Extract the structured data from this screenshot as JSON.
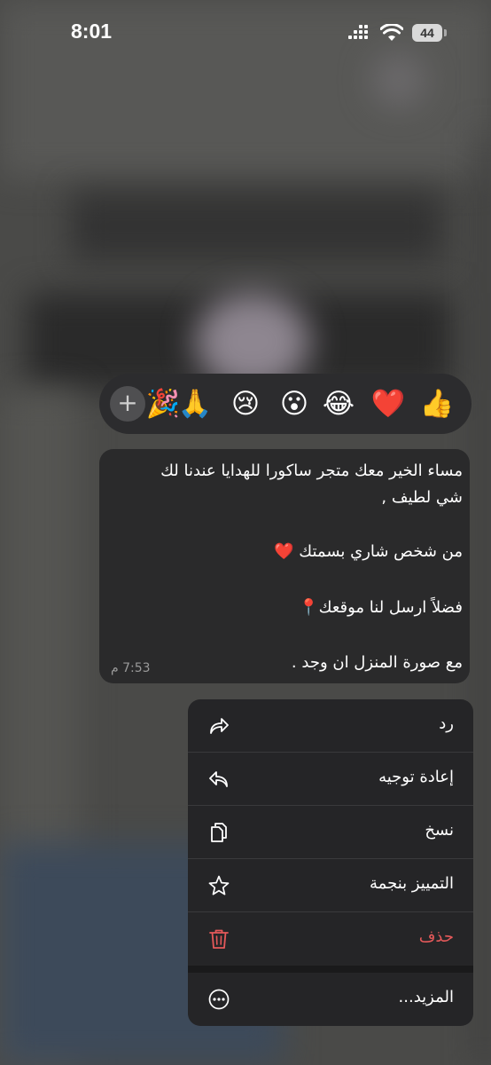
{
  "status_bar": {
    "time": "8:01",
    "battery": "44"
  },
  "reactions": {
    "items": [
      {
        "name": "thumbs-up",
        "glyph": "👍"
      },
      {
        "name": "red-heart",
        "glyph": "❤️"
      },
      {
        "name": "tears-of-joy",
        "glyph": "😂"
      },
      {
        "name": "surprised",
        "glyph": "😮"
      },
      {
        "name": "crying",
        "glyph": "😢"
      },
      {
        "name": "folded-hands",
        "glyph": "🙏"
      },
      {
        "name": "party-popper",
        "glyph": "🎉"
      }
    ],
    "add_label": "+"
  },
  "message": {
    "lines": [
      "مساء الخير معك متجر ساكورا للهدايا  عندنا لك",
      "شي لطيف ,",
      "من شخص شاري بسمتك ❤️",
      "فضلاً ارسل لنا موقعك📍",
      "مع صورة المنزل ان وجد ."
    ],
    "time": "7:53 م"
  },
  "menu": {
    "reply": "رد",
    "forward": "إعادة توجيه",
    "copy": "نسخ",
    "star": "التمييز بنجمة",
    "delete": "حذف",
    "more": "المزيد..."
  },
  "colors": {
    "delete": "#e5595a",
    "bubble": "#2a2a2b",
    "menu": "#252527"
  }
}
